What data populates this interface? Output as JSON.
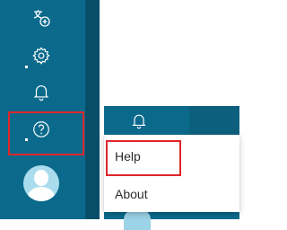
{
  "nav_rail": {
    "items": [
      {
        "icon": "translate-icon"
      },
      {
        "icon": "gear-icon"
      },
      {
        "icon": "bell-icon"
      },
      {
        "icon": "help-icon"
      }
    ],
    "avatar_icon": "user-avatar-icon"
  },
  "help_menu": {
    "items": [
      "Help",
      "About"
    ]
  },
  "colors": {
    "rail": "#0b6a8c",
    "rail_dark": "#094e69",
    "highlight": "#e0262b",
    "menu_bg": "#ffffff",
    "icon": "#ffffff"
  }
}
